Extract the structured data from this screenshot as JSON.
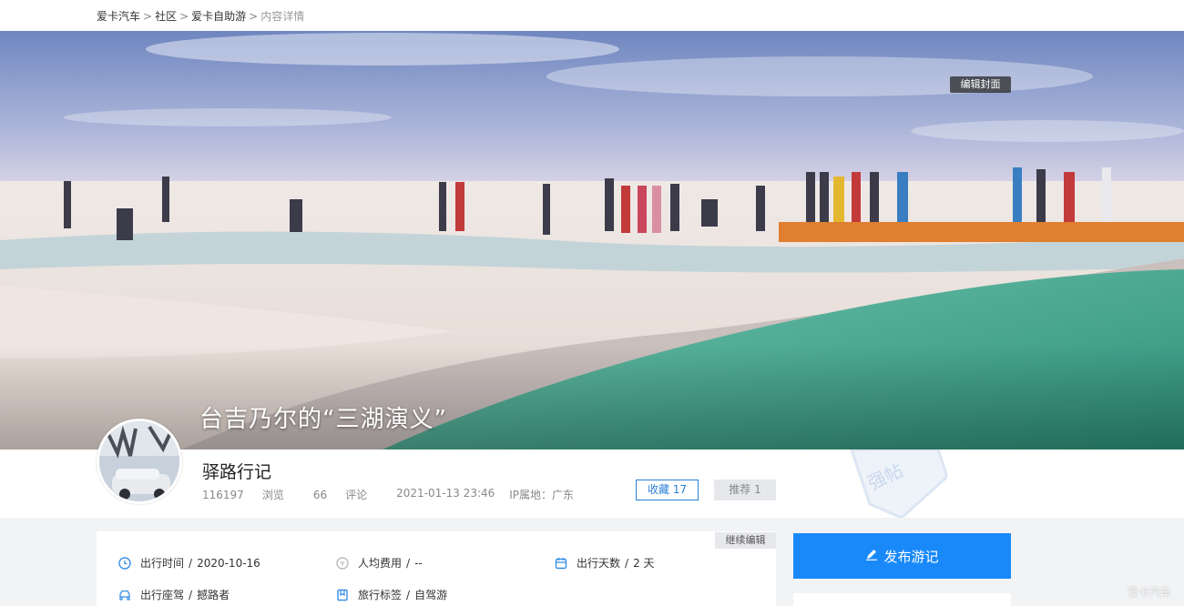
{
  "breadcrumb": {
    "items": [
      "爱卡汽车",
      "社区",
      "爱卡自助游"
    ],
    "current": "内容详情",
    "separator": ">"
  },
  "hero": {
    "edit_cover_label": "编辑封面",
    "title": "台吉乃尔的“三湖演义”"
  },
  "author": {
    "name": "驿路行记",
    "views": "116197",
    "views_label": "浏览",
    "comments": "66",
    "comments_label": "评论",
    "datetime": "2021-01-13 23:46",
    "ip_location": "IP属地：广东"
  },
  "actions": {
    "collect_label": "收藏 17",
    "recommend_label": "推荐 1"
  },
  "watermark_text": "强帖",
  "info": {
    "continue_edit_label": "继续编辑",
    "items": [
      {
        "label": "出行时间",
        "value": "2020-10-16",
        "icon": "clock-icon"
      },
      {
        "label": "人均费用",
        "value": "--",
        "icon": "coin-icon"
      },
      {
        "label": "出行天数",
        "value": "2 天",
        "icon": "calendar-icon"
      },
      {
        "label": "出行座驾",
        "value": "撼路者",
        "icon": "car-icon"
      },
      {
        "label": "旅行标签",
        "value": "自驾游",
        "icon": "bookmark-icon"
      }
    ],
    "divider": "/"
  },
  "sidebar": {
    "publish_label": "发布游记"
  },
  "corner_mark": "爱卡汽车",
  "colors": {
    "accent": "#1989fa",
    "collect": "#2b7fd6",
    "icon": "#3a8ee6"
  }
}
